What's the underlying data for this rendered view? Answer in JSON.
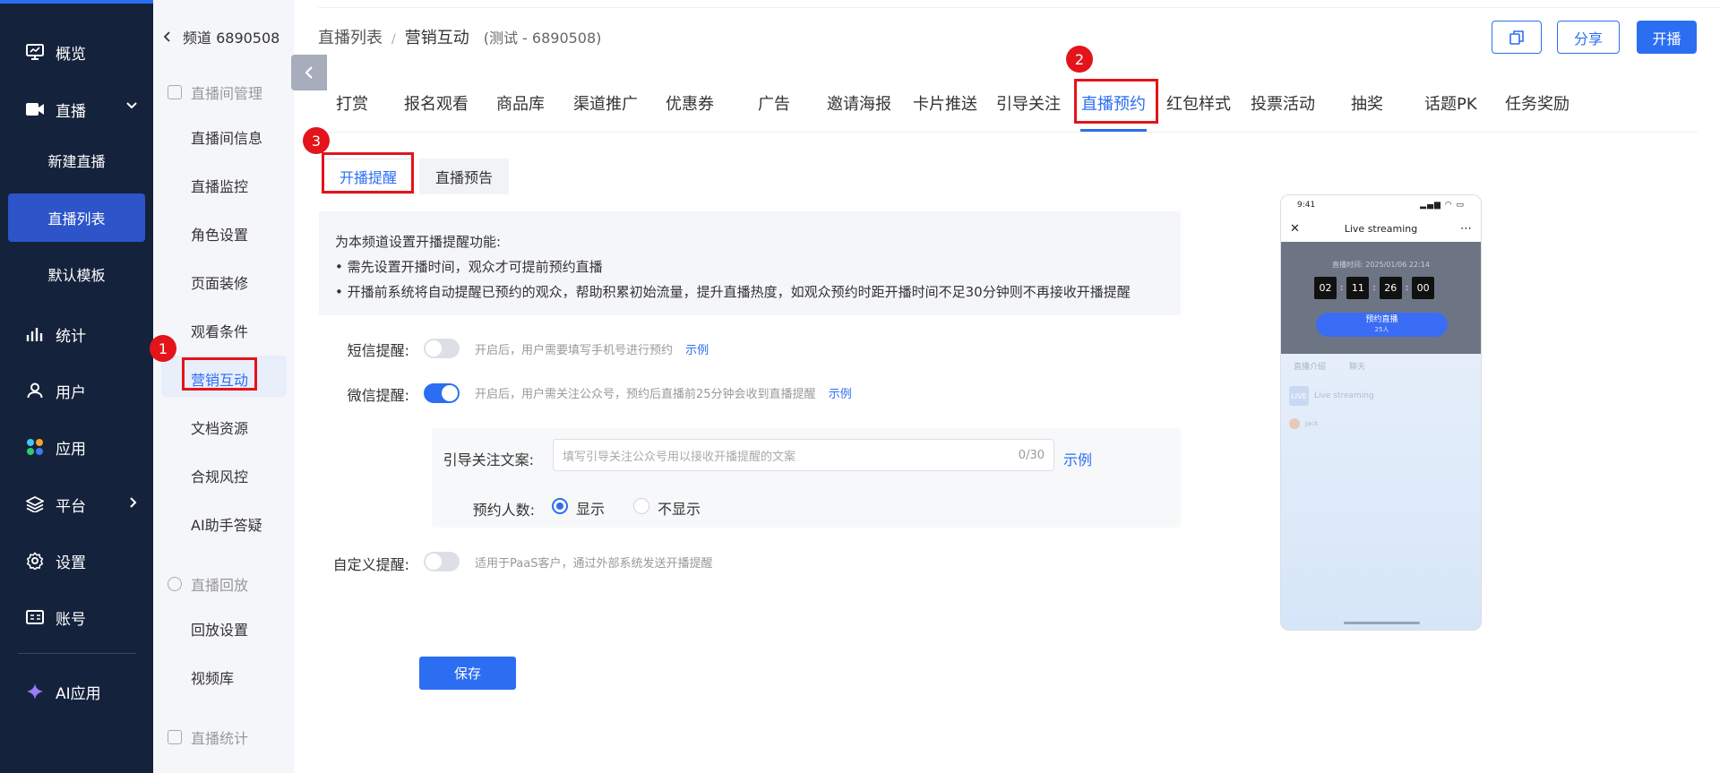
{
  "nav": {
    "items": [
      {
        "label": "概览",
        "icon": "monitor-icon"
      },
      {
        "label": "直播",
        "icon": "video-icon"
      },
      {
        "label": "统计",
        "icon": "bar-chart-icon"
      },
      {
        "label": "用户",
        "icon": "user-icon"
      },
      {
        "label": "应用",
        "icon": "apps-icon"
      },
      {
        "label": "平台",
        "icon": "layers-icon"
      },
      {
        "label": "设置",
        "icon": "gear-icon"
      },
      {
        "label": "账号",
        "icon": "id-card-icon"
      },
      {
        "label": "AI应用",
        "icon": "sparkle-icon"
      }
    ],
    "live_sub": [
      "新建直播",
      "直播列表",
      "默认模板"
    ]
  },
  "side": {
    "back": "频道 6890508",
    "group1": "直播间管理",
    "items1": [
      "直播间信息",
      "直播监控",
      "角色设置",
      "页面装修",
      "观看条件",
      "营销互动",
      "文档资源",
      "合规风控",
      "AI助手答疑"
    ],
    "group2": "直播回放",
    "items2": [
      "回放设置",
      "视频库"
    ],
    "group3": "直播统计"
  },
  "markers": [
    "1",
    "2",
    "3"
  ],
  "header": {
    "crumb1": "直播列表",
    "crumb_sep": "/",
    "crumb2": "营销互动",
    "sub": "(测试 - 6890508)",
    "share": "分享",
    "start": "开播"
  },
  "tabs": [
    "打赏",
    "报名观看",
    "商品库",
    "渠道推广",
    "优惠券",
    "广告",
    "邀请海报",
    "卡片推送",
    "引导关注",
    "直播预约",
    "红包样式",
    "投票活动",
    "抽奖",
    "话题PK",
    "任务奖励"
  ],
  "subtabs": [
    "开播提醒",
    "直播预告"
  ],
  "notice": {
    "line1": "为本频道设置开播提醒功能:",
    "line2": "• 需先设置开播时间，观众才可提前预约直播",
    "line3": "• 开播前系统将自动提醒已预约的观众，帮助积累初始流量，提升直播热度，如观众预约时距开播时间不足30分钟则不再接收开播提醒"
  },
  "form": {
    "sms_label": "短信提醒:",
    "sms_on": false,
    "sms_hint": "开启后，用户需要填写手机号进行预约",
    "example": "示例",
    "wx_label": "微信提醒:",
    "wx_on": true,
    "wx_hint": "开启后，用户需关注公众号，预约后直播前25分钟会收到直播提醒",
    "guide_label": "引导关注文案:",
    "guide_placeholder": "填写引导关注公众号用以接收开播提醒的文案",
    "guide_count": "0/30",
    "count_label": "预约人数:",
    "show": "显示",
    "hide": "不显示",
    "custom_label": "自定义提醒:",
    "custom_on": false,
    "custom_hint": "适用于PaaS客户，通过外部系统发送开播提醒",
    "save": "保存"
  },
  "phone": {
    "time": "9:41",
    "title": "Live streaming",
    "live_time": "直播时间: 2025/01/06 22:14",
    "countdown": [
      "02",
      "11",
      "26",
      "00"
    ],
    "units": [
      "天",
      "时",
      "分",
      "秒"
    ],
    "btn": "预约直播",
    "btn_sub": "25人",
    "tab1": "直播介绍",
    "tab2": "聊天",
    "live_badge": "LIVE",
    "live_name": "Live streaming",
    "user": "Jack"
  },
  "colors": {
    "accent": "#2b6ef2",
    "nav_bg": "#15223c",
    "marker": "#e3141b"
  }
}
